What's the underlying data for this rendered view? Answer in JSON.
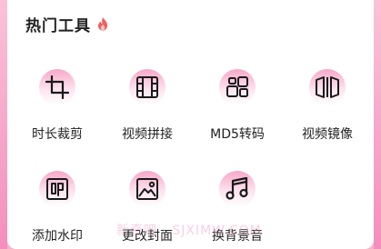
{
  "header": {
    "title": "热门工具",
    "badge_icon": "fire-icon"
  },
  "tools": [
    {
      "label": "时长裁剪",
      "icon": "crop-icon"
    },
    {
      "label": "视频拼接",
      "icon": "film-icon"
    },
    {
      "label": "MD5转码",
      "icon": "grid-squares-icon"
    },
    {
      "label": "视频镜像",
      "icon": "mirror-icon"
    },
    {
      "label": "添加水印",
      "icon": "watermark-stamp-icon"
    },
    {
      "label": "更改封面",
      "icon": "image-icon"
    },
    {
      "label": "换背景音",
      "icon": "music-note-icon"
    }
  ],
  "watermark": "新奇吧 · SJXIMW.COM",
  "colors": {
    "accent": "#f38fbc",
    "icon_stroke": "#1a1a1a",
    "fire": "#f25f5c"
  }
}
